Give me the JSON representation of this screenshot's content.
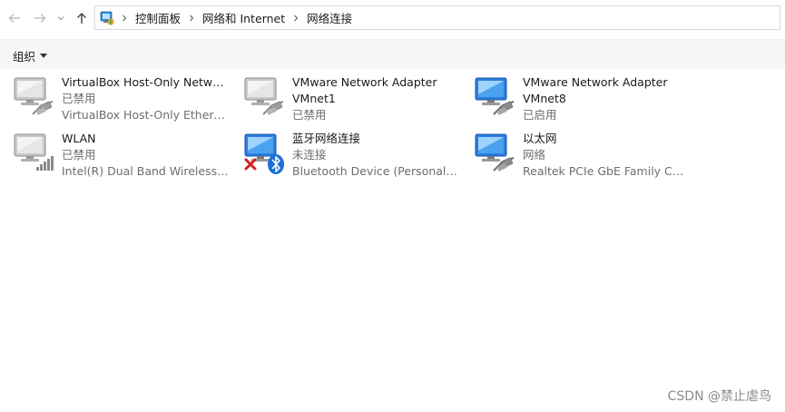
{
  "nav": {
    "back_icon": "arrow-left-icon",
    "forward_icon": "arrow-right-icon",
    "recent_icon": "chevron-down-icon",
    "up_icon": "arrow-up-icon"
  },
  "address": {
    "breadcrumbs": [
      "控制面板",
      "网络和 Internet",
      "网络连接"
    ]
  },
  "command_bar": {
    "organize_label": "组织"
  },
  "connections": [
    {
      "name": "VirtualBox Host-Only Network",
      "line2": "已禁用",
      "line3": "VirtualBox Host-Only Ethernet ...",
      "state": "disabled",
      "kind": "ethernet"
    },
    {
      "name": "VMware Network Adapter VMnet1",
      "line1b": "VMnet1",
      "line2": "已禁用",
      "state": "disabled",
      "kind": "ethernet"
    },
    {
      "name": "VMware Network Adapter",
      "line1b": "VMnet8",
      "line2": "已启用",
      "state": "enabled",
      "kind": "ethernet"
    },
    {
      "name": "WLAN",
      "line2": "已禁用",
      "line3": "Intel(R) Dual Band Wireless-A...",
      "state": "disabled",
      "kind": "wireless"
    },
    {
      "name": "蓝牙网络连接",
      "line2": "未连接",
      "line3": "Bluetooth Device (Personal Ar...",
      "state": "disconnected",
      "kind": "bluetooth"
    },
    {
      "name": "以太网",
      "line2": "网络",
      "line3": "Realtek PCIe GbE Family Contr...",
      "state": "enabled",
      "kind": "ethernet"
    }
  ],
  "labels": {
    "vmnet1_title": "VMware Network Adapter",
    "vmnet1_sub": "VMnet1"
  },
  "watermark": "CSDN @禁止虐鸟",
  "colors": {
    "monitor_enabled": "#2b7de1",
    "monitor_disabled": "#9a9a9a",
    "bluetooth": "#1b6fd8",
    "error_x": "#d61f1f"
  }
}
